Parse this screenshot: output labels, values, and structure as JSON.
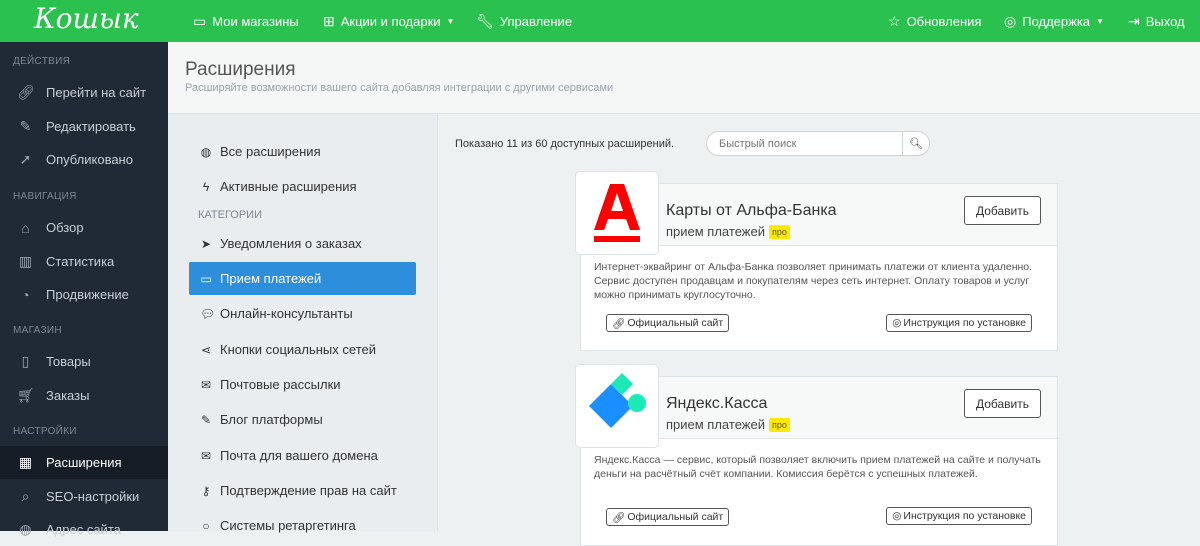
{
  "header": {
    "logo": "Кошык",
    "nav": [
      {
        "icon": "inbox-icon",
        "label": "Мои магазины"
      },
      {
        "icon": "gift-icon",
        "label": "Акции и подарки"
      },
      {
        "icon": "wrench-icon",
        "label": "Управление"
      }
    ],
    "right": [
      {
        "icon": "star-icon",
        "label": "Обновления"
      },
      {
        "icon": "lifebuoy-icon",
        "label": "Поддержка"
      },
      {
        "icon": "logout-icon",
        "label": "Выход"
      }
    ]
  },
  "sidebar": {
    "sections": [
      "ДЕЙСТВИЯ",
      "НАВИГАЦИЯ",
      "МАГАЗИН",
      "НАСТРОЙКИ"
    ],
    "items": [
      "Перейти на сайт",
      "Редактировать",
      "Опубликовано",
      "Обзор",
      "Статистика",
      "Продвижение",
      "Товары",
      "Заказы",
      "Расширения",
      "SEO-настройки",
      "Адрес сайта"
    ]
  },
  "page": {
    "title": "Расширения",
    "subtitle": "Расширяйте возможности вашего сайта добавляя интеграции с другими сервисами"
  },
  "submenu": {
    "top": [
      "Все расширения",
      "Активные расширения"
    ],
    "categories_label": "КАТЕГОРИИ",
    "items": [
      "Уведомления о заказах",
      "Прием платежей",
      "Онлайн-консультанты",
      "Кнопки социальных сетей",
      "Почтовые рассылки",
      "Блог платформы",
      "Почта для вашего домена",
      "Подтверждение прав на сайт",
      "Системы ретаргетинга"
    ]
  },
  "main": {
    "count": "Показано 11 из 60 доступных расширений.",
    "search_placeholder": "Быстрый поиск",
    "cards": [
      {
        "title": "Карты от Альфа-Банка",
        "category": "прием платежей",
        "badge": "про",
        "add": "Добавить",
        "desc": "Интернет-эквайринг от Альфа-Банка позволяет принимать платежи от клиента удаленно. Сервис доступен продавцам и покупателям через сеть интернет. Оплату товаров и услуг можно принимать круглосуточно.",
        "site": "Официальный сайт",
        "guide": "Инструкция по установке"
      },
      {
        "title": "Яндекс.Касса",
        "category": "прием платежей",
        "badge": "про",
        "add": "Добавить",
        "desc": "Яндекс.Касса — сервис, который позволяет включить прием платежей на сайте и получать деньги на расчётный счёт компании. Комиссия берётся с успешных платежей.",
        "site": "Официальный сайт",
        "guide": "Инструкция по установке"
      }
    ]
  }
}
